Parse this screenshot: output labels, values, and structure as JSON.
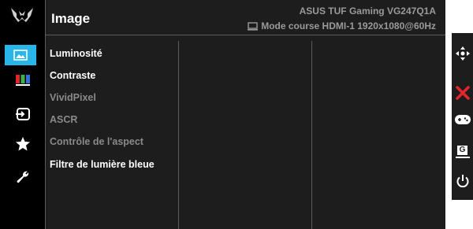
{
  "header": {
    "title": "Image",
    "model": "ASUS TUF Gaming VG247Q1A",
    "mode": "Mode course HDMI-1 1920x1080@60Hz"
  },
  "sidebar": {
    "logo": "tuf-logo",
    "items": [
      {
        "icon": "image-icon",
        "active": true
      },
      {
        "icon": "color-icon",
        "active": false
      },
      {
        "icon": "input-select-icon",
        "active": false
      },
      {
        "icon": "star-icon",
        "active": false
      },
      {
        "icon": "wrench-icon",
        "active": false
      }
    ]
  },
  "menu": {
    "items": [
      {
        "label": "Luminosité",
        "enabled": true
      },
      {
        "label": "Contraste",
        "enabled": true
      },
      {
        "label": "VividPixel",
        "enabled": false
      },
      {
        "label": "ASCR",
        "enabled": false
      },
      {
        "label": "Contrôle de l'aspect",
        "enabled": false
      },
      {
        "label": "Filtre de lumière bleue",
        "enabled": true
      }
    ]
  },
  "keys": {
    "items": [
      "move-joystick-icon",
      "close-icon",
      "gamepad-icon",
      "gameplus-icon",
      "power-icon"
    ],
    "gameplus_letter": "G"
  },
  "colors": {
    "accent": "#29b5e8",
    "close": "#e2262b",
    "background": "#1d1d1d"
  }
}
